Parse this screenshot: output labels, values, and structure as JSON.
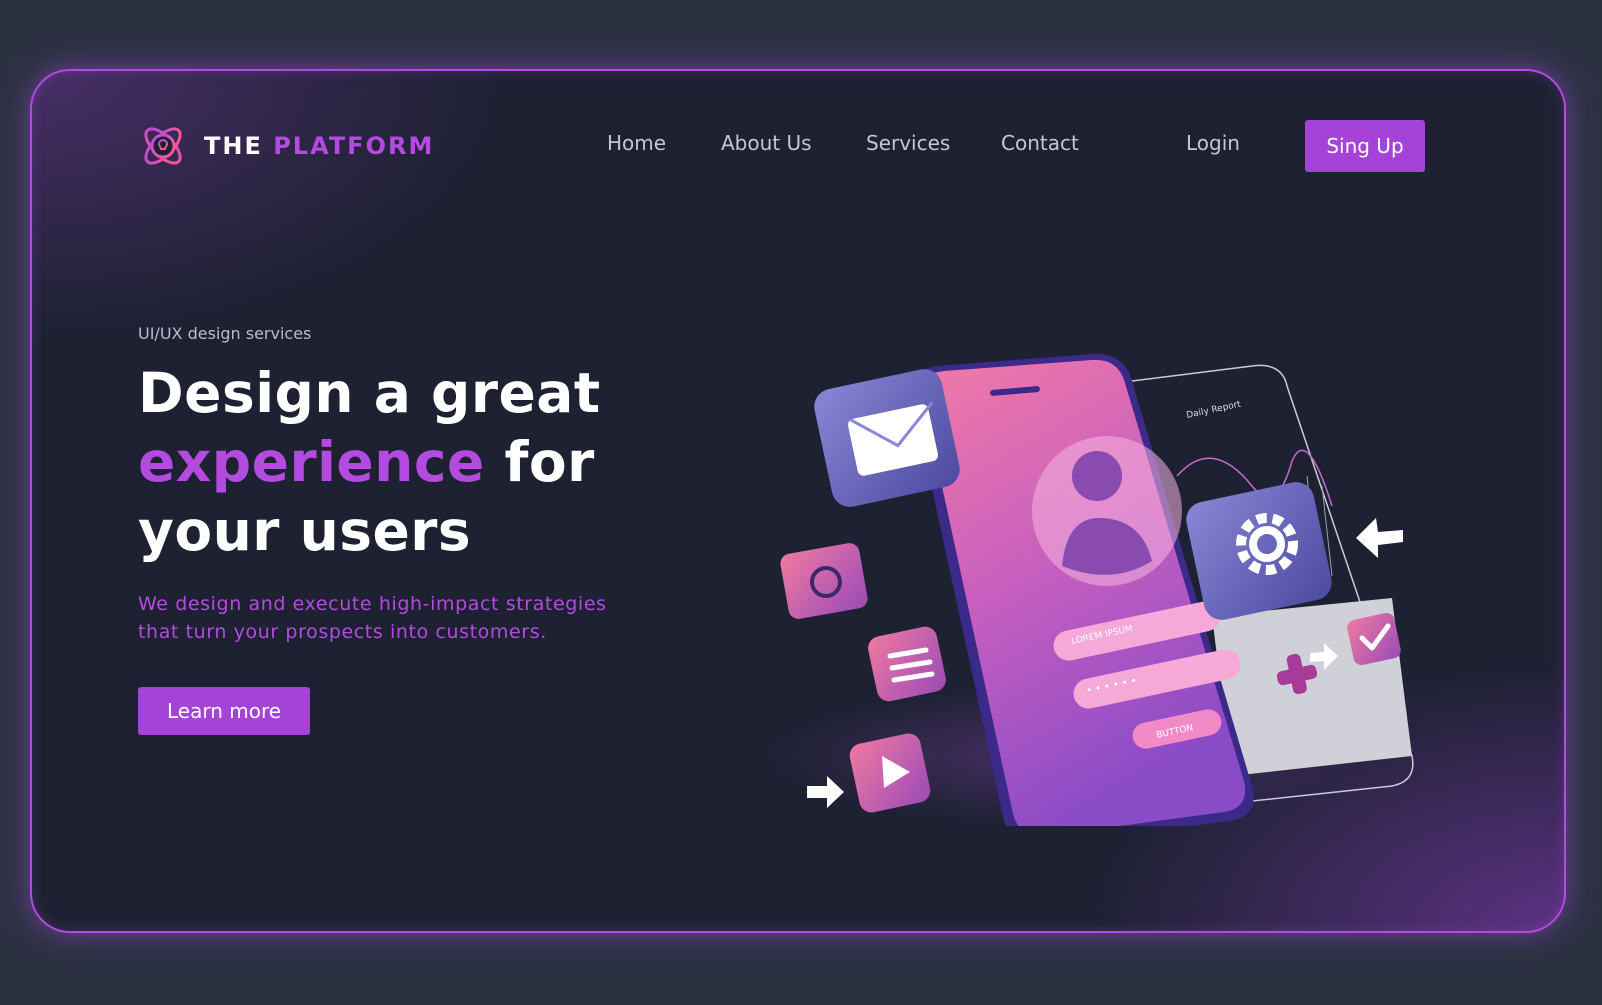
{
  "brand": {
    "name_part1": "THE",
    "name_part2": "PLATFORM",
    "accent_color": "#b44be0",
    "icon": "lightbulb-orbit-icon"
  },
  "nav": {
    "items": [
      {
        "label": "Home"
      },
      {
        "label": "About Us"
      },
      {
        "label": "Services"
      },
      {
        "label": "Contact"
      }
    ],
    "login_label": "Login",
    "signup_label": "Sing Up"
  },
  "hero": {
    "eyebrow": "UI/UX design services",
    "headline_line1": "Design a great",
    "headline_highlight": "experience",
    "headline_for": "for",
    "headline_line3": "your users",
    "subtext_line1": "We design and execute high-impact strategies",
    "subtext_line2": "that turn your prospects into customers.",
    "cta_label": "Learn more"
  },
  "illustration": {
    "report_title": "Daily Report",
    "input_label": "LOREM IPSUM",
    "password_mask": "• • • • • •",
    "button_label": "BUTTON",
    "icons": [
      "mail-icon",
      "camera-icon",
      "document-icon",
      "play-icon",
      "gear-icon",
      "checkmark-icon",
      "user-avatar-icon",
      "plus-icon",
      "arrow-icon"
    ]
  },
  "colors": {
    "background": "#2c3142",
    "card": "#1d2132",
    "accent": "#a542d8",
    "nav_text": "#c3c6d6"
  }
}
